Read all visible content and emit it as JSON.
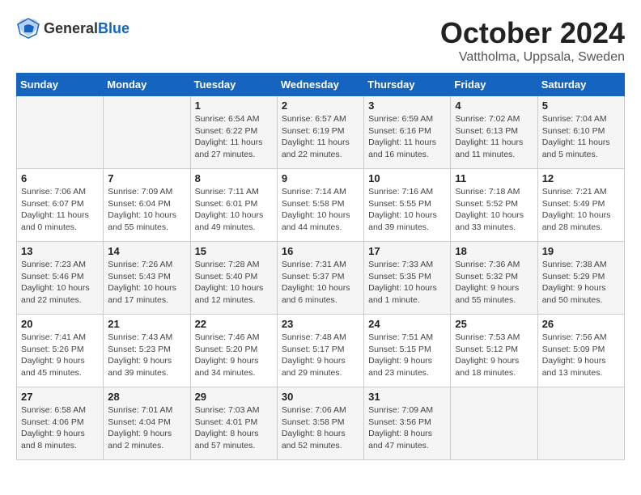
{
  "header": {
    "logo_general": "General",
    "logo_blue": "Blue",
    "month": "October 2024",
    "location": "Vattholma, Uppsala, Sweden"
  },
  "weekdays": [
    "Sunday",
    "Monday",
    "Tuesday",
    "Wednesday",
    "Thursday",
    "Friday",
    "Saturday"
  ],
  "weeks": [
    [
      {
        "day": "",
        "info": ""
      },
      {
        "day": "",
        "info": ""
      },
      {
        "day": "1",
        "info": "Sunrise: 6:54 AM\nSunset: 6:22 PM\nDaylight: 11 hours and 27 minutes."
      },
      {
        "day": "2",
        "info": "Sunrise: 6:57 AM\nSunset: 6:19 PM\nDaylight: 11 hours and 22 minutes."
      },
      {
        "day": "3",
        "info": "Sunrise: 6:59 AM\nSunset: 6:16 PM\nDaylight: 11 hours and 16 minutes."
      },
      {
        "day": "4",
        "info": "Sunrise: 7:02 AM\nSunset: 6:13 PM\nDaylight: 11 hours and 11 minutes."
      },
      {
        "day": "5",
        "info": "Sunrise: 7:04 AM\nSunset: 6:10 PM\nDaylight: 11 hours and 5 minutes."
      }
    ],
    [
      {
        "day": "6",
        "info": "Sunrise: 7:06 AM\nSunset: 6:07 PM\nDaylight: 11 hours and 0 minutes."
      },
      {
        "day": "7",
        "info": "Sunrise: 7:09 AM\nSunset: 6:04 PM\nDaylight: 10 hours and 55 minutes."
      },
      {
        "day": "8",
        "info": "Sunrise: 7:11 AM\nSunset: 6:01 PM\nDaylight: 10 hours and 49 minutes."
      },
      {
        "day": "9",
        "info": "Sunrise: 7:14 AM\nSunset: 5:58 PM\nDaylight: 10 hours and 44 minutes."
      },
      {
        "day": "10",
        "info": "Sunrise: 7:16 AM\nSunset: 5:55 PM\nDaylight: 10 hours and 39 minutes."
      },
      {
        "day": "11",
        "info": "Sunrise: 7:18 AM\nSunset: 5:52 PM\nDaylight: 10 hours and 33 minutes."
      },
      {
        "day": "12",
        "info": "Sunrise: 7:21 AM\nSunset: 5:49 PM\nDaylight: 10 hours and 28 minutes."
      }
    ],
    [
      {
        "day": "13",
        "info": "Sunrise: 7:23 AM\nSunset: 5:46 PM\nDaylight: 10 hours and 22 minutes."
      },
      {
        "day": "14",
        "info": "Sunrise: 7:26 AM\nSunset: 5:43 PM\nDaylight: 10 hours and 17 minutes."
      },
      {
        "day": "15",
        "info": "Sunrise: 7:28 AM\nSunset: 5:40 PM\nDaylight: 10 hours and 12 minutes."
      },
      {
        "day": "16",
        "info": "Sunrise: 7:31 AM\nSunset: 5:37 PM\nDaylight: 10 hours and 6 minutes."
      },
      {
        "day": "17",
        "info": "Sunrise: 7:33 AM\nSunset: 5:35 PM\nDaylight: 10 hours and 1 minute."
      },
      {
        "day": "18",
        "info": "Sunrise: 7:36 AM\nSunset: 5:32 PM\nDaylight: 9 hours and 55 minutes."
      },
      {
        "day": "19",
        "info": "Sunrise: 7:38 AM\nSunset: 5:29 PM\nDaylight: 9 hours and 50 minutes."
      }
    ],
    [
      {
        "day": "20",
        "info": "Sunrise: 7:41 AM\nSunset: 5:26 PM\nDaylight: 9 hours and 45 minutes."
      },
      {
        "day": "21",
        "info": "Sunrise: 7:43 AM\nSunset: 5:23 PM\nDaylight: 9 hours and 39 minutes."
      },
      {
        "day": "22",
        "info": "Sunrise: 7:46 AM\nSunset: 5:20 PM\nDaylight: 9 hours and 34 minutes."
      },
      {
        "day": "23",
        "info": "Sunrise: 7:48 AM\nSunset: 5:17 PM\nDaylight: 9 hours and 29 minutes."
      },
      {
        "day": "24",
        "info": "Sunrise: 7:51 AM\nSunset: 5:15 PM\nDaylight: 9 hours and 23 minutes."
      },
      {
        "day": "25",
        "info": "Sunrise: 7:53 AM\nSunset: 5:12 PM\nDaylight: 9 hours and 18 minutes."
      },
      {
        "day": "26",
        "info": "Sunrise: 7:56 AM\nSunset: 5:09 PM\nDaylight: 9 hours and 13 minutes."
      }
    ],
    [
      {
        "day": "27",
        "info": "Sunrise: 6:58 AM\nSunset: 4:06 PM\nDaylight: 9 hours and 8 minutes."
      },
      {
        "day": "28",
        "info": "Sunrise: 7:01 AM\nSunset: 4:04 PM\nDaylight: 9 hours and 2 minutes."
      },
      {
        "day": "29",
        "info": "Sunrise: 7:03 AM\nSunset: 4:01 PM\nDaylight: 8 hours and 57 minutes."
      },
      {
        "day": "30",
        "info": "Sunrise: 7:06 AM\nSunset: 3:58 PM\nDaylight: 8 hours and 52 minutes."
      },
      {
        "day": "31",
        "info": "Sunrise: 7:09 AM\nSunset: 3:56 PM\nDaylight: 8 hours and 47 minutes."
      },
      {
        "day": "",
        "info": ""
      },
      {
        "day": "",
        "info": ""
      }
    ]
  ]
}
